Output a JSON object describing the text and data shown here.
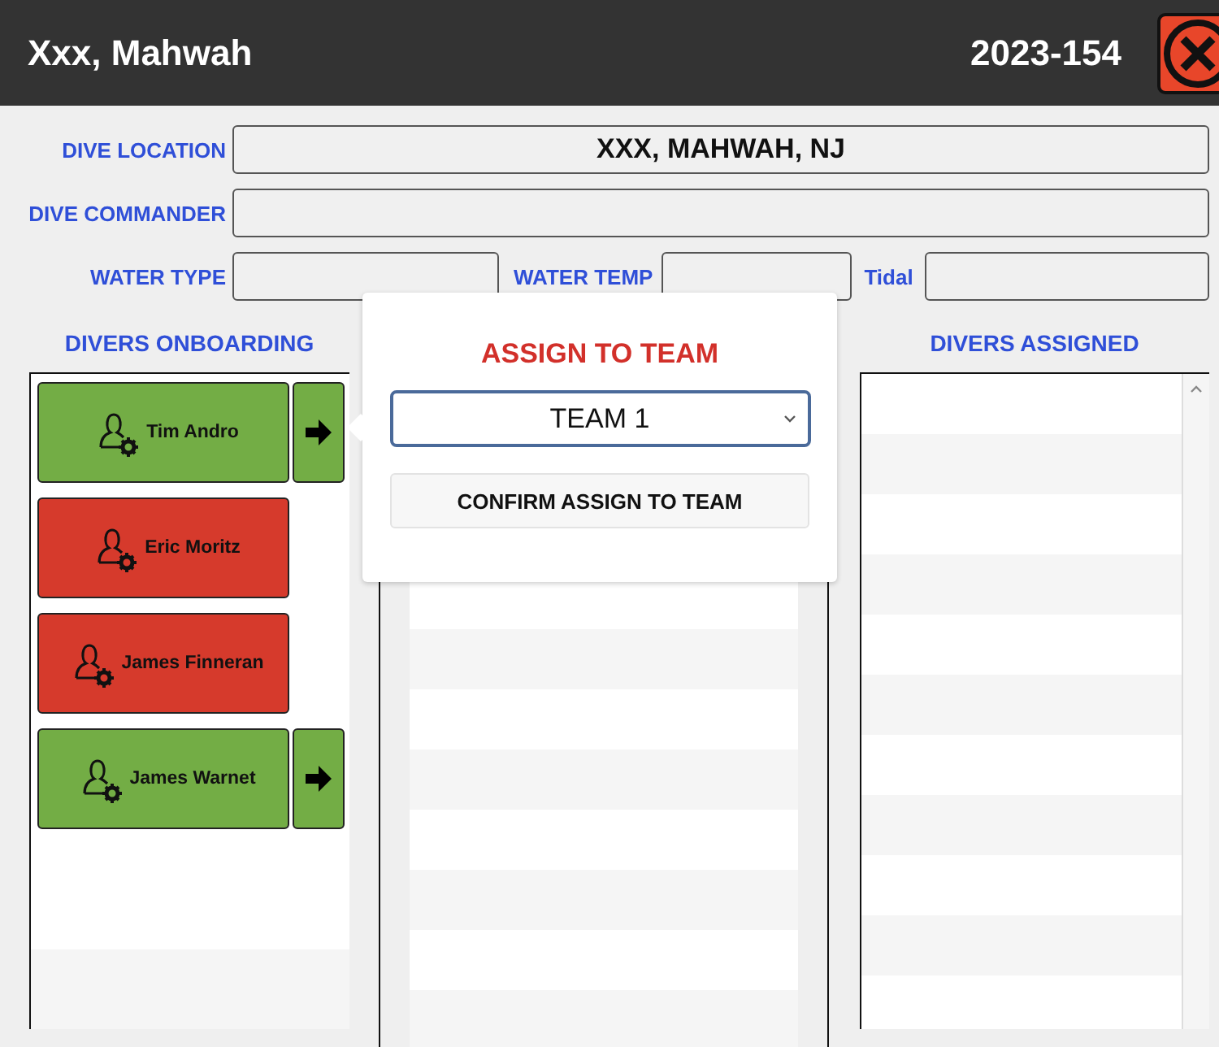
{
  "header": {
    "title": "Xxx, Mahwah",
    "case_number": "2023-154"
  },
  "form": {
    "dive_location": {
      "label": "DIVE LOCATION",
      "value": "XXX, MAHWAH, NJ"
    },
    "dive_commander": {
      "label": "DIVE COMMANDER"
    },
    "water_type": {
      "label": "WATER TYPE"
    },
    "water_temp": {
      "label": "WATER TEMP"
    },
    "tidal": {
      "label": "Tidal"
    }
  },
  "divers_onboarding": {
    "title": "DIVERS ONBOARDING",
    "divers": [
      {
        "name": "Tim Andro",
        "color": "#73ad45",
        "assignable": true
      },
      {
        "name": "Eric Moritz",
        "color": "#d63a2c",
        "assignable": false
      },
      {
        "name": "James Finneran",
        "color": "#d63a2c",
        "assignable": false
      },
      {
        "name": "James Warnet",
        "color": "#73ad45",
        "assignable": true
      }
    ]
  },
  "divers_assigned": {
    "title": "DIVERS ASSIGNED"
  },
  "assign_popover": {
    "title": "ASSIGN TO TEAM",
    "team_select": "TEAM 1",
    "confirm_button": "CONFIRM ASSIGN TO TEAM"
  }
}
